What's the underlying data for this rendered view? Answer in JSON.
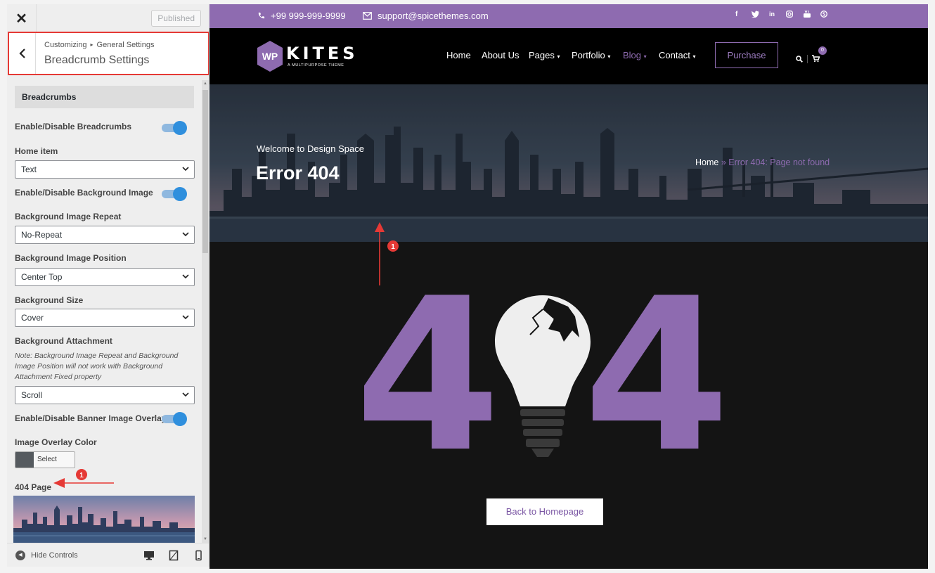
{
  "customizer": {
    "published_label": "Published",
    "breadcrumb_root": "Customizing",
    "breadcrumb_parent": "General Settings",
    "title": "Breadcrumb Settings",
    "section_header": "Breadcrumbs",
    "enable_breadcrumbs_label": "Enable/Disable Breadcrumbs",
    "enable_breadcrumbs_on": true,
    "home_item_label": "Home item",
    "home_item_value": "Text",
    "enable_bg_image_label": "Enable/Disable Background Image",
    "enable_bg_image_on": true,
    "bg_repeat_label": "Background Image Repeat",
    "bg_repeat_value": "No-Repeat",
    "bg_position_label": "Background Image Position",
    "bg_position_value": "Center Top",
    "bg_size_label": "Background Size",
    "bg_size_value": "Cover",
    "bg_attachment_label": "Background Attachment",
    "bg_attachment_note": "Note: Background Image Repeat and Background Image Position will not work with Background Attachment Fixed property",
    "bg_attachment_value": "Scroll",
    "banner_overlay_label": "Enable/Disable Banner Image Overlay",
    "banner_overlay_on": true,
    "overlay_color_label": "Image Overlay Color",
    "overlay_color_button": "Select Color",
    "overlay_color": "#555a5f",
    "page404_label": "404 Page",
    "hide_controls_label": "Hide Controls"
  },
  "site": {
    "phone": "+99 999-999-9999",
    "email": "support@spicethemes.com",
    "logo_name": "KITES",
    "logo_mark": "WP",
    "logo_tagline": "A MULTIPURPOSE THEME",
    "nav": [
      "Home",
      "About Us",
      "Pages",
      "Portfolio",
      "Blog",
      "Contact"
    ],
    "nav_active": "Blog",
    "purchase_label": "Purchase",
    "cart_count": "0",
    "hero_subtitle": "Welcome to Design Space",
    "hero_title": "Error 404",
    "crumb_home": "Home",
    "crumb_sep": " » ",
    "crumb_current": "Error 404: Page not found",
    "big_404_left": "4",
    "big_404_right": "4",
    "back_home_label": "Back to Homepage"
  },
  "annotations": [
    "1",
    "1"
  ],
  "colors": {
    "accent": "#8e6bb0",
    "annotation_red": "#e53935",
    "toggle_blue": "#2f8fdd"
  }
}
